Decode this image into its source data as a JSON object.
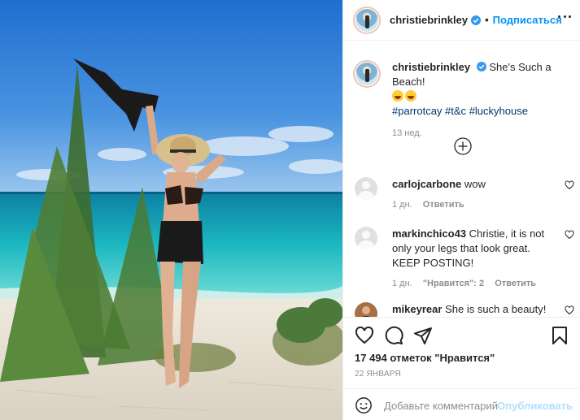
{
  "post": {
    "author": "christiebrinkley",
    "follow_label": "Подписаться",
    "separator": "•"
  },
  "caption": {
    "username": "christiebrinkley",
    "text": "She's Such a Beach!",
    "hashtags": [
      "#parrotcay",
      "#t&c",
      "#luckyhouse"
    ],
    "time": "13 нед."
  },
  "comments": [
    {
      "username": "carlojcarbone",
      "text": "wow",
      "time": "1 дн.",
      "likes": "",
      "reply": "Ответить"
    },
    {
      "username": "markinchico43",
      "text": "Christie, it is not only your legs that look great. KEEP POSTING!",
      "time": "1 дн.",
      "likes": "\"Нравится\": 2",
      "reply": "Ответить"
    },
    {
      "username": "mikeyrear",
      "text": "She is such a beauty!",
      "time": "",
      "likes": "",
      "reply": ""
    }
  ],
  "actions": {
    "likes_text": "17 494 отметок \"Нравится\"",
    "date": "22 ЯНВАРЯ"
  },
  "add_comment": {
    "placeholder": "Добавьте комментарий...",
    "publish_label": "Опубликовать"
  },
  "colors": {
    "link": "#0095f6",
    "hashtag": "#00376b",
    "muted": "#8e8e8e",
    "publish_disabled": "#b2dffc"
  },
  "icons": [
    "verified-badge-icon",
    "more-options-icon",
    "load-more-plus-icon",
    "heart-icon",
    "comment-icon",
    "share-icon",
    "bookmark-icon",
    "emoji-icon"
  ]
}
